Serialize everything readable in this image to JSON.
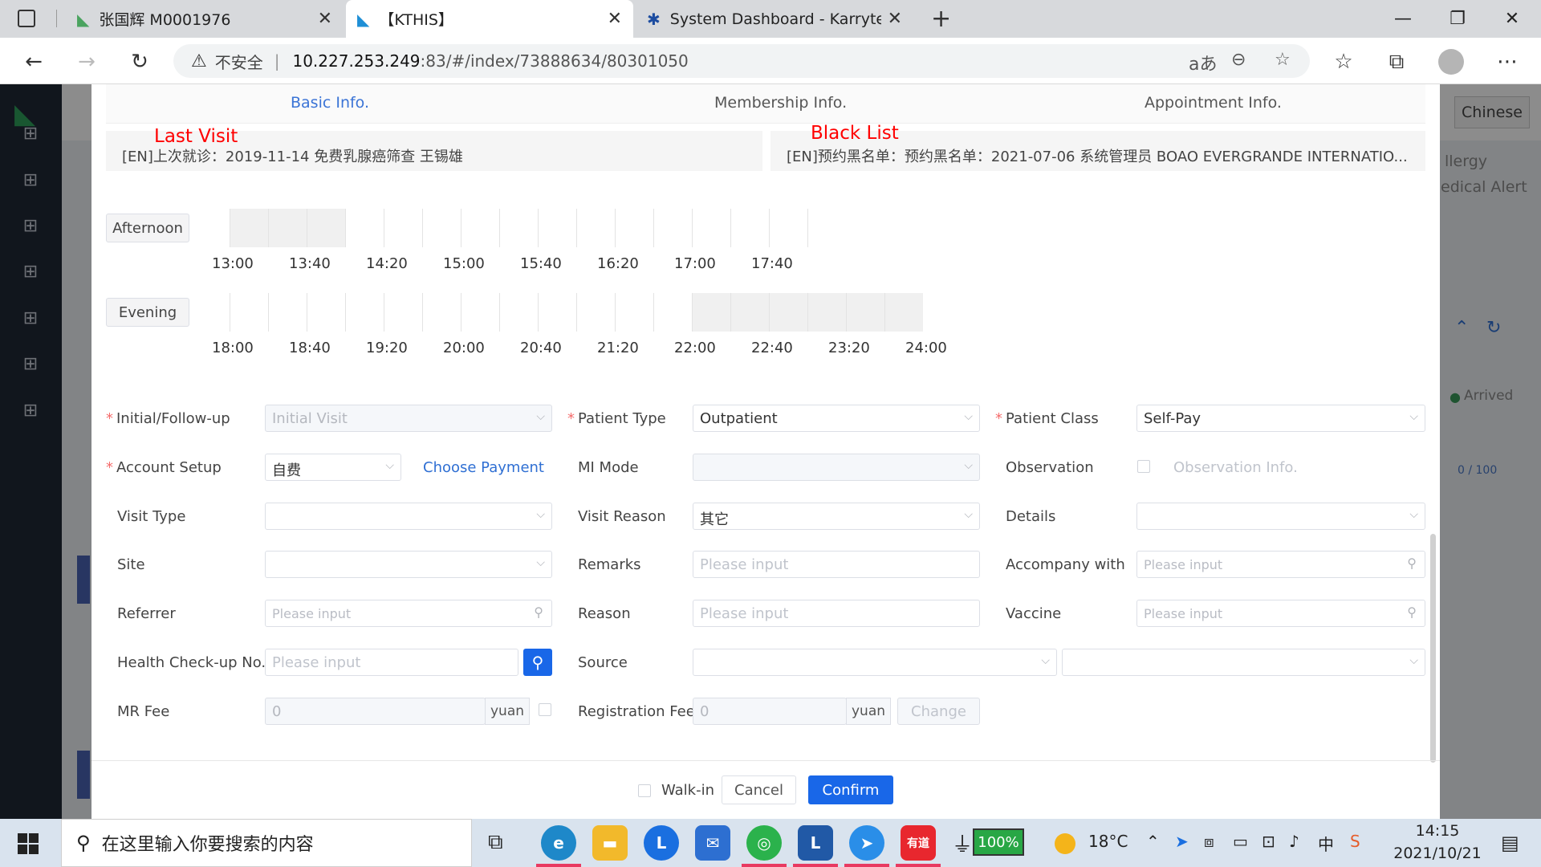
{
  "browser": {
    "tabs": [
      {
        "title": "张国辉 M0001976"
      },
      {
        "title": "【KTHIS】"
      },
      {
        "title": "System Dashboard - Karrytech JI"
      }
    ],
    "address": {
      "insecure_label": "不安全",
      "host": "10.227.253.249",
      "path": ":83/#/index/73888634/80301050"
    }
  },
  "background_app": {
    "language_button": "Chinese",
    "right_labels": [
      "llergy",
      "edical Alert",
      "Arrived",
      "0 / 100"
    ]
  },
  "modal": {
    "tabs": [
      {
        "label": "Basic Info."
      },
      {
        "label": "Membership Info."
      },
      {
        "label": "Appointment Info."
      }
    ],
    "last_visit": {
      "heading": "Last Visit",
      "text": "[EN]上次就诊：2019-11-14 免费乳腺癌筛查 王锡雄"
    },
    "black_list": {
      "heading": "Black List",
      "text": "[EN]预约黑名单：预约黑名单：2021-07-06 系统管理员 BOAO EVERGRANDE INTERNATIO..."
    },
    "schedule": {
      "afternoon": {
        "label": "Afternoon",
        "ticks": [
          "13:00",
          "13:40",
          "14:20",
          "15:00",
          "15:40",
          "16:20",
          "17:00",
          "17:40"
        ],
        "busy": [
          0,
          1,
          2
        ]
      },
      "evening": {
        "label": "Evening",
        "ticks": [
          "18:00",
          "18:40",
          "19:20",
          "20:00",
          "20:40",
          "21:20",
          "22:00",
          "22:40",
          "23:20",
          "24:00"
        ],
        "busy": [
          12,
          13,
          14,
          15,
          16,
          17
        ]
      }
    },
    "form": {
      "initial_followup": {
        "label": "Initial/Follow-up",
        "value": "Initial Visit"
      },
      "patient_type": {
        "label": "Patient Type",
        "value": "Outpatient"
      },
      "patient_class": {
        "label": "Patient Class",
        "value": "Self-Pay"
      },
      "account_setup": {
        "label": "Account Setup",
        "value": "自费",
        "link": "Choose Payment"
      },
      "mi_mode": {
        "label": "MI Mode"
      },
      "observation": {
        "label": "Observation",
        "info": "Observation Info."
      },
      "visit_type": {
        "label": "Visit Type"
      },
      "visit_reason": {
        "label": "Visit Reason",
        "value": "其它"
      },
      "details": {
        "label": "Details"
      },
      "site": {
        "label": "Site"
      },
      "remarks": {
        "label": "Remarks",
        "placeholder": "Please input"
      },
      "accompany_with": {
        "label": "Accompany with",
        "placeholder": "Please input"
      },
      "referrer": {
        "label": "Referrer",
        "placeholder": "Please input"
      },
      "reason": {
        "label": "Reason",
        "placeholder": "Please input"
      },
      "vaccine": {
        "label": "Vaccine",
        "placeholder": "Please input"
      },
      "health_checkup": {
        "label": "Health Check-up No.",
        "placeholder": "Please input"
      },
      "source": {
        "label": "Source"
      },
      "mr_fee": {
        "label": "MR Fee",
        "value": "0",
        "unit": "yuan"
      },
      "registration_fee": {
        "label": "Registration Fee",
        "value": "0",
        "unit": "yuan",
        "change": "Change"
      }
    },
    "footer": {
      "walk_in": "Walk-in",
      "cancel": "Cancel",
      "confirm": "Confirm"
    }
  },
  "taskbar": {
    "search_placeholder": "在这里输入你要搜索的内容",
    "battery": "100%",
    "weather": "18°C",
    "ime": "中",
    "time": "14:15",
    "date": "2021/10/21",
    "youdao_label": "有道"
  }
}
